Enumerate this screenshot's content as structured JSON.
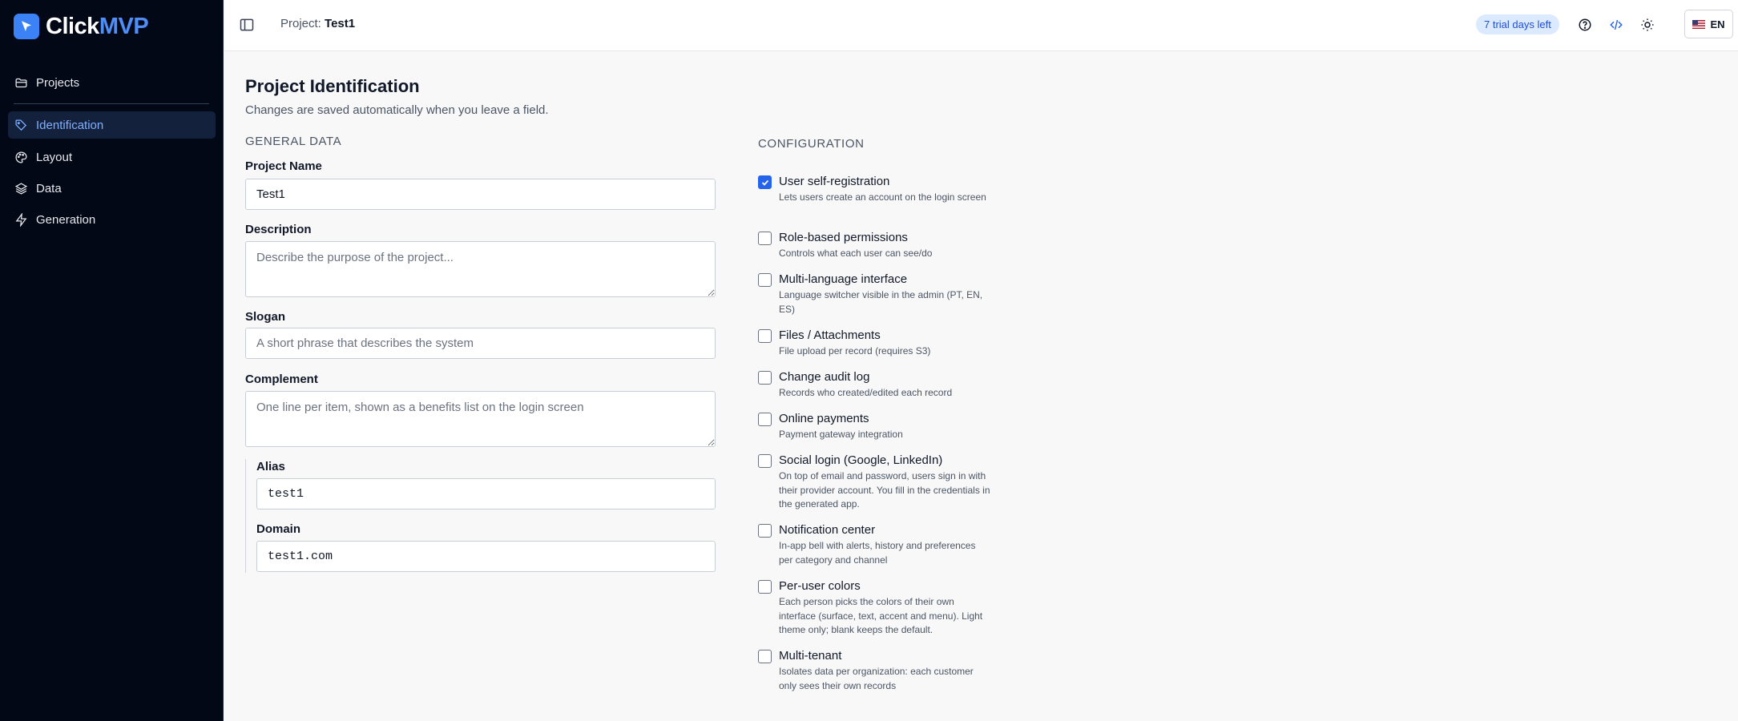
{
  "app": {
    "logo_part1": "Click",
    "logo_part2": "MVP"
  },
  "sidebar": {
    "items": [
      {
        "label": "Projects",
        "icon": "folder-icon"
      },
      {
        "label": "Identification",
        "icon": "tag-icon"
      },
      {
        "label": "Layout",
        "icon": "palette-icon"
      },
      {
        "label": "Data",
        "icon": "layers-icon"
      },
      {
        "label": "Generation",
        "icon": "zap-icon"
      }
    ],
    "active": "Identification"
  },
  "topbar": {
    "project_prefix": "Project:",
    "project_name": "Test1",
    "trial_badge": "7 trial days left",
    "language": "EN"
  },
  "page": {
    "title": "Project Identification",
    "subtitle": "Changes are saved automatically when you leave a field."
  },
  "general": {
    "section_title": "GENERAL DATA",
    "project_name_label": "Project Name",
    "project_name_value": "Test1",
    "description_label": "Description",
    "description_placeholder": "Describe the purpose of the project...",
    "slogan_label": "Slogan",
    "slogan_placeholder": "A short phrase that describes the system",
    "complement_label": "Complement",
    "complement_placeholder": "One line per item, shown as a benefits list on the login screen",
    "alias_label": "Alias",
    "alias_value": "test1",
    "domain_label": "Domain",
    "domain_value": "test1.com"
  },
  "configuration": {
    "section_title": "CONFIGURATION",
    "options": [
      {
        "title": "User self-registration",
        "desc": "Lets users create an account on the login screen",
        "checked": true
      },
      {
        "title": "Role-based permissions",
        "desc": "Controls what each user can see/do",
        "checked": false
      },
      {
        "title": "Multi-language interface",
        "desc": "Language switcher visible in the admin (PT, EN, ES)",
        "checked": false
      },
      {
        "title": "Files / Attachments",
        "desc": "File upload per record (requires S3)",
        "checked": false
      },
      {
        "title": "Change audit log",
        "desc": "Records who created/edited each record",
        "checked": false
      },
      {
        "title": "Online payments",
        "desc": "Payment gateway integration",
        "checked": false
      },
      {
        "title": "Social login (Google, LinkedIn)",
        "desc": "On top of email and password, users sign in with their provider account. You fill in the credentials in the generated app.",
        "checked": false
      },
      {
        "title": "Notification center",
        "desc": "In-app bell with alerts, history and preferences per category and channel",
        "checked": false
      },
      {
        "title": "Per-user colors",
        "desc": "Each person picks the colors of their own interface (surface, text, accent and menu). Light theme only; blank keeps the default.",
        "checked": false
      },
      {
        "title": "Multi-tenant",
        "desc": "Isolates data per organization: each customer only sees their own records",
        "checked": false
      }
    ]
  },
  "colors": {
    "sidebar_bg": "#030816",
    "accent": "#3b82f6",
    "active_nav_bg": "#14213d",
    "trial_badge_bg": "#dbeafe"
  }
}
